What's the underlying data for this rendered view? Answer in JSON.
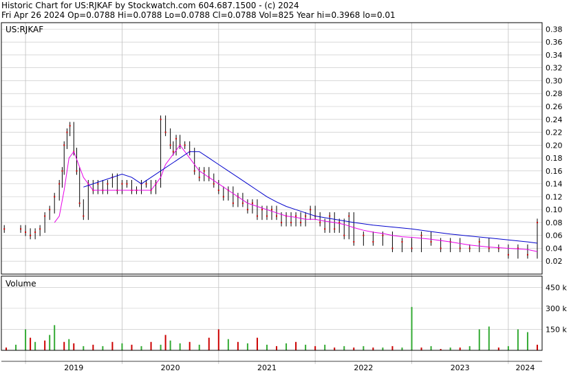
{
  "header": {
    "line1": "Historic Chart for US:RJKAF by Stockwatch.com 604.687.1500 - (c) 2024",
    "line2": "Fri Apr 26 2024   Op=0.0788  Hi=0.0788  Lo=0.0788  Cl=0.0788  Vol=825   Year hi=0.3968  lo=0.01"
  },
  "colors": {
    "price": "#000000",
    "price_dot": "#cc0000",
    "ma_short": "#e800e8",
    "ma_long": "#0000cc",
    "vol_up": "#33aa33",
    "vol_down": "#cc0000",
    "grid": "#c0c0c0"
  },
  "chart_data": [
    {
      "type": "line",
      "title": "US:RJKAF",
      "ylim": [
        0,
        0.39
      ],
      "y_ticks": [
        "0.02",
        "0.04",
        "0.06",
        "0.08",
        "0.10",
        "0.12",
        "0.14",
        "0.16",
        "0.18",
        "0.20",
        "0.22",
        "0.24",
        "0.26",
        "0.28",
        "0.30",
        "0.32",
        "0.34",
        "0.36",
        "0.38"
      ],
      "x_labels": [
        "2019",
        "2020",
        "2021",
        "2022",
        "2023",
        "2024"
      ],
      "x_unit": "years",
      "x_range": [
        2018.75,
        2024.35
      ],
      "grid": true,
      "series": [
        {
          "role": "price",
          "x": [
            2018.78,
            2018.95,
            2019.0,
            2019.05,
            2019.1,
            2019.15,
            2019.2,
            2019.25,
            2019.3,
            2019.35,
            2019.38,
            2019.4,
            2019.43,
            2019.46,
            2019.5,
            2019.53,
            2019.56,
            2019.6,
            2019.65,
            2019.7,
            2019.75,
            2019.8,
            2019.85,
            2019.9,
            2019.95,
            2020.0,
            2020.05,
            2020.1,
            2020.15,
            2020.2,
            2020.25,
            2020.3,
            2020.35,
            2020.4,
            2020.45,
            2020.5,
            2020.53,
            2020.56,
            2020.6,
            2020.65,
            2020.7,
            2020.75,
            2020.8,
            2020.85,
            2020.9,
            2020.95,
            2021.0,
            2021.05,
            2021.1,
            2021.15,
            2021.2,
            2021.25,
            2021.3,
            2021.35,
            2021.4,
            2021.45,
            2021.5,
            2021.55,
            2021.6,
            2021.65,
            2021.7,
            2021.75,
            2021.8,
            2021.85,
            2021.9,
            2021.95,
            2022.0,
            2022.05,
            2022.1,
            2022.15,
            2022.2,
            2022.25,
            2022.3,
            2022.35,
            2022.4,
            2022.5,
            2022.6,
            2022.7,
            2022.8,
            2022.9,
            2023.0,
            2023.1,
            2023.2,
            2023.3,
            2023.4,
            2023.5,
            2023.6,
            2023.7,
            2023.8,
            2023.9,
            2024.0,
            2024.1,
            2024.2,
            2024.3
          ],
          "values": [
            0.07,
            0.07,
            0.065,
            0.06,
            0.065,
            0.07,
            0.09,
            0.1,
            0.12,
            0.14,
            0.16,
            0.2,
            0.22,
            0.23,
            0.19,
            0.16,
            0.11,
            0.09,
            0.14,
            0.13,
            0.14,
            0.13,
            0.14,
            0.15,
            0.13,
            0.14,
            0.14,
            0.13,
            0.13,
            0.14,
            0.14,
            0.13,
            0.14,
            0.24,
            0.22,
            0.2,
            0.19,
            0.21,
            0.2,
            0.2,
            0.19,
            0.16,
            0.15,
            0.16,
            0.15,
            0.14,
            0.13,
            0.12,
            0.13,
            0.11,
            0.12,
            0.11,
            0.1,
            0.11,
            0.09,
            0.1,
            0.09,
            0.1,
            0.09,
            0.08,
            0.09,
            0.08,
            0.09,
            0.08,
            0.09,
            0.1,
            0.09,
            0.08,
            0.07,
            0.09,
            0.07,
            0.08,
            0.06,
            0.09,
            0.05,
            0.06,
            0.05,
            0.06,
            0.04,
            0.05,
            0.04,
            0.06,
            0.05,
            0.04,
            0.05,
            0.04,
            0.04,
            0.05,
            0.04,
            0.04,
            0.03,
            0.04,
            0.03,
            0.08
          ]
        },
        {
          "role": "ma_short",
          "x": [
            2019.3,
            2019.35,
            2019.4,
            2019.45,
            2019.5,
            2019.55,
            2019.6,
            2019.7,
            2019.8,
            2019.9,
            2020.0,
            2020.1,
            2020.2,
            2020.3,
            2020.4,
            2020.45,
            2020.5,
            2020.55,
            2020.6,
            2020.65,
            2020.7,
            2020.8,
            2020.9,
            2021.0,
            2021.1,
            2021.2,
            2021.3,
            2021.4,
            2021.5,
            2021.6,
            2021.7,
            2021.8,
            2021.9,
            2022.0,
            2022.1,
            2022.2,
            2022.3,
            2022.4,
            2022.5,
            2022.6,
            2022.7,
            2022.8,
            2022.9,
            2023.0,
            2023.2,
            2023.4,
            2023.6,
            2023.8,
            2024.0,
            2024.2,
            2024.3
          ],
          "values": [
            0.08,
            0.09,
            0.13,
            0.18,
            0.19,
            0.17,
            0.15,
            0.13,
            0.13,
            0.13,
            0.13,
            0.13,
            0.13,
            0.13,
            0.15,
            0.17,
            0.18,
            0.19,
            0.2,
            0.19,
            0.18,
            0.16,
            0.15,
            0.14,
            0.13,
            0.12,
            0.11,
            0.105,
            0.1,
            0.095,
            0.09,
            0.088,
            0.085,
            0.085,
            0.082,
            0.08,
            0.077,
            0.072,
            0.068,
            0.065,
            0.063,
            0.06,
            0.058,
            0.057,
            0.054,
            0.05,
            0.045,
            0.042,
            0.04,
            0.038,
            0.035
          ]
        },
        {
          "role": "ma_long",
          "x": [
            2019.6,
            2019.8,
            2020.0,
            2020.1,
            2020.2,
            2020.3,
            2020.4,
            2020.5,
            2020.6,
            2020.7,
            2020.8,
            2020.9,
            2021.0,
            2021.1,
            2021.2,
            2021.3,
            2021.4,
            2021.5,
            2021.6,
            2021.7,
            2021.8,
            2021.9,
            2022.0,
            2022.2,
            2022.4,
            2022.6,
            2022.8,
            2023.0,
            2023.2,
            2023.4,
            2023.6,
            2023.8,
            2024.0,
            2024.2,
            2024.3
          ],
          "values": [
            0.135,
            0.145,
            0.155,
            0.15,
            0.14,
            0.15,
            0.16,
            0.17,
            0.18,
            0.19,
            0.19,
            0.18,
            0.17,
            0.16,
            0.15,
            0.14,
            0.13,
            0.12,
            0.112,
            0.105,
            0.1,
            0.095,
            0.09,
            0.085,
            0.08,
            0.076,
            0.073,
            0.07,
            0.066,
            0.062,
            0.059,
            0.056,
            0.053,
            0.05,
            0.048
          ]
        }
      ]
    },
    {
      "type": "bar",
      "title": "Volume",
      "ylim": [
        0,
        530
      ],
      "y_ticks": [
        "150 k",
        "300 k",
        "450 k"
      ],
      "unit": "k",
      "x": [
        2018.8,
        2018.9,
        2019.0,
        2019.05,
        2019.1,
        2019.2,
        2019.25,
        2019.3,
        2019.4,
        2019.45,
        2019.5,
        2019.6,
        2019.7,
        2019.8,
        2019.9,
        2020.0,
        2020.1,
        2020.2,
        2020.3,
        2020.4,
        2020.45,
        2020.5,
        2020.6,
        2020.7,
        2020.8,
        2020.9,
        2021.0,
        2021.1,
        2021.2,
        2021.3,
        2021.4,
        2021.5,
        2021.6,
        2021.7,
        2021.8,
        2021.9,
        2022.0,
        2022.1,
        2022.2,
        2022.3,
        2022.4,
        2022.5,
        2022.6,
        2022.7,
        2022.8,
        2022.9,
        2023.0,
        2023.1,
        2023.2,
        2023.3,
        2023.4,
        2023.5,
        2023.6,
        2023.7,
        2023.8,
        2023.9,
        2024.0,
        2024.1,
        2024.2,
        2024.3
      ],
      "values": [
        20,
        40,
        150,
        90,
        60,
        70,
        110,
        180,
        60,
        80,
        50,
        30,
        40,
        30,
        60,
        50,
        40,
        30,
        60,
        40,
        110,
        70,
        50,
        60,
        40,
        90,
        150,
        80,
        60,
        50,
        90,
        40,
        30,
        50,
        60,
        40,
        30,
        40,
        20,
        30,
        20,
        30,
        20,
        20,
        30,
        20,
        310,
        20,
        30,
        10,
        20,
        20,
        30,
        150,
        170,
        20,
        30,
        150,
        130,
        40
      ],
      "direction": [
        "down",
        "up",
        "up",
        "down",
        "up",
        "down",
        "up",
        "up",
        "down",
        "up",
        "down",
        "up",
        "down",
        "up",
        "down",
        "up",
        "down",
        "up",
        "down",
        "up",
        "down",
        "up",
        "up",
        "down",
        "up",
        "down",
        "down",
        "up",
        "down",
        "up",
        "down",
        "up",
        "down",
        "up",
        "down",
        "up",
        "down",
        "up",
        "down",
        "up",
        "down",
        "up",
        "down",
        "up",
        "down",
        "up",
        "up",
        "down",
        "up",
        "down",
        "up",
        "down",
        "up",
        "up",
        "up",
        "down",
        "up",
        "up",
        "up",
        "down"
      ]
    }
  ]
}
